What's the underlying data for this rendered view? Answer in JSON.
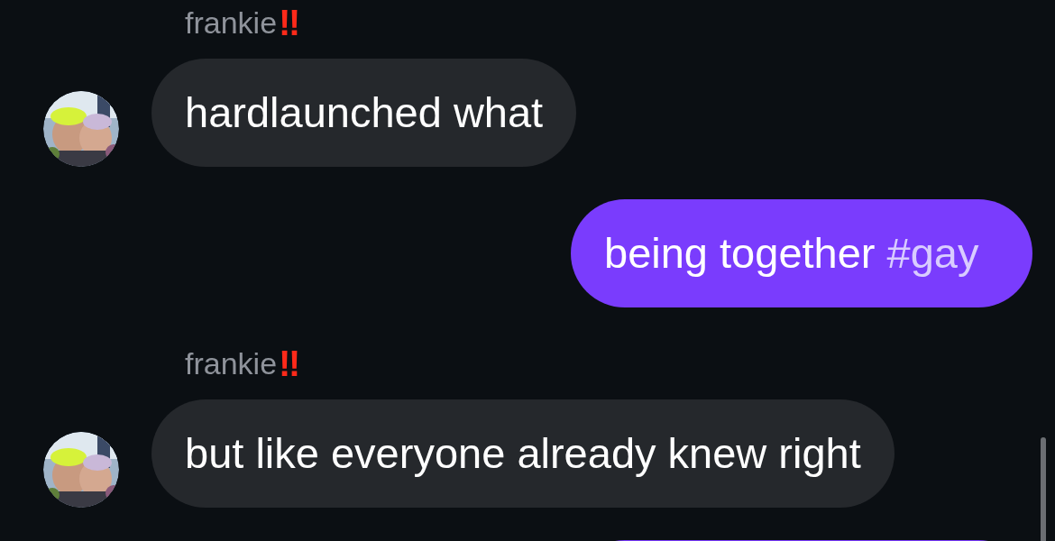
{
  "messages": [
    {
      "kind": "received",
      "sender": "frankie",
      "sender_badge": "‼",
      "text": "hardlaunched what"
    },
    {
      "kind": "sent",
      "text": "being together ",
      "hashtag": "#gay"
    },
    {
      "kind": "received",
      "sender": "frankie",
      "sender_badge": "‼",
      "text": "but like everyone already knew right"
    },
    {
      "kind": "sent"
    }
  ]
}
